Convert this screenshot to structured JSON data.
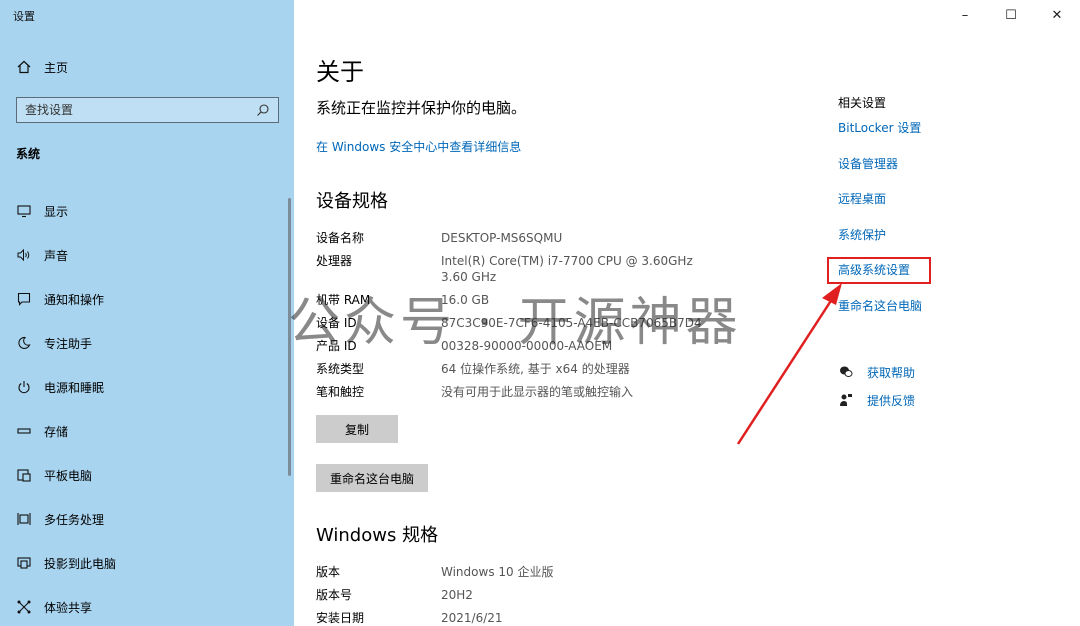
{
  "window": {
    "title": "设置",
    "minimize": "–",
    "maximize": "☐",
    "close": "✕"
  },
  "sidebar": {
    "home_label": "主页",
    "search_placeholder": "查找设置",
    "section_label": "系统",
    "items": [
      {
        "label": "显示",
        "icon": "monitor-icon"
      },
      {
        "label": "声音",
        "icon": "speaker-icon"
      },
      {
        "label": "通知和操作",
        "icon": "notification-icon"
      },
      {
        "label": "专注助手",
        "icon": "moon-icon"
      },
      {
        "label": "电源和睡眠",
        "icon": "power-icon"
      },
      {
        "label": "存储",
        "icon": "storage-icon"
      },
      {
        "label": "平板电脑",
        "icon": "tablet-icon"
      },
      {
        "label": "多任务处理",
        "icon": "multitask-icon"
      },
      {
        "label": "投影到此电脑",
        "icon": "project-icon"
      },
      {
        "label": "体验共享",
        "icon": "share-icon"
      }
    ]
  },
  "main": {
    "title": "关于",
    "status": "系统正在监控并保护你的电脑。",
    "security_link": "在 Windows 安全中心中查看详细信息",
    "device_spec_title": "设备规格",
    "device_specs": [
      {
        "k": "设备名称",
        "v": "DESKTOP-MS6SQMU"
      },
      {
        "k": "处理器",
        "v": "Intel(R) Core(TM) i7-7700 CPU @ 3.60GHz   3.60 GHz"
      },
      {
        "k": "机带 RAM",
        "v": "16.0 GB"
      },
      {
        "k": "设备 ID",
        "v": "87C3C90E-7CF6-4105-A4EB-CCB7065B7D4"
      },
      {
        "k": "产品 ID",
        "v": "00328-90000-00000-AAOEM"
      },
      {
        "k": "系统类型",
        "v": "64 位操作系统, 基于 x64 的处理器"
      },
      {
        "k": "笔和触控",
        "v": "没有可用于此显示器的笔或触控输入"
      }
    ],
    "copy_button": "复制",
    "rename_button": "重命名这台电脑",
    "windows_spec_title": "Windows 规格",
    "windows_specs": [
      {
        "k": "版本",
        "v": "Windows 10 企业版"
      },
      {
        "k": "版本号",
        "v": "20H2"
      },
      {
        "k": "安装日期",
        "v": "2021/6/21"
      }
    ]
  },
  "related": {
    "title": "相关设置",
    "links": [
      "BitLocker 设置",
      "设备管理器",
      "远程桌面",
      "系统保护",
      "高级系统设置",
      "重命名这台电脑"
    ],
    "help_label": "获取帮助",
    "feedback_label": "提供反馈"
  },
  "watermark": "公众号 · 开源神器",
  "colors": {
    "sidebar": "#a9d4ef",
    "link": "#0067b8",
    "highlight": "#e02020"
  }
}
